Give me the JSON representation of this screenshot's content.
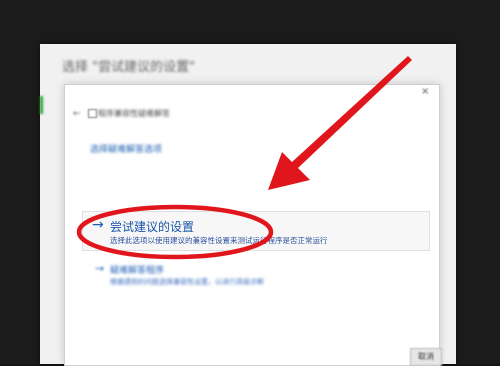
{
  "window": {
    "title": "选择 \"尝试建议的设置\""
  },
  "dialog": {
    "title": "程序兼容性疑难解答",
    "close_glyph": "×",
    "back_glyph": "←",
    "heading": "选择疑难解答选项"
  },
  "options": [
    {
      "arrow": "→",
      "title": "尝试建议的设置",
      "description": "选择此选项以使用建议的兼容性设置来测试运行程序是否正常运行"
    },
    {
      "arrow": "→",
      "title": "疑难解答程序",
      "description": "根据遇到的问题选择兼容性设置，以进行高级诊断"
    }
  ],
  "footer": {
    "cancel_label": "取消"
  },
  "annotations": {
    "accent_color": "#e0161c"
  }
}
